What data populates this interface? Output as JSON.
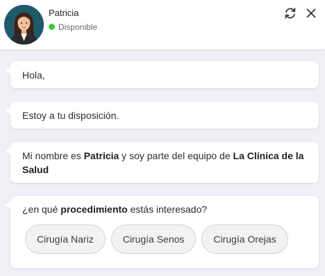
{
  "header": {
    "agent_name": "Patricia",
    "status": "Disponible",
    "status_color": "#43c63f",
    "icons": [
      "refresh-icon",
      "close-icon"
    ]
  },
  "messages": [
    {
      "text": "Hola,"
    },
    {
      "text": "Estoy a tu disposición."
    },
    {
      "parts": {
        "p1": "Mi nombre es ",
        "b1": "Patricia",
        "p2": " y soy parte del equipo de ",
        "b2": "La Clínica de la Salud"
      }
    },
    {
      "parts": {
        "p1": "¿en qué ",
        "b1": "procedimiento",
        "p2": " estás interesado?"
      },
      "options": [
        "Cirugía Nariz",
        "Cirugía Senos",
        "Cirugía Orejas"
      ]
    }
  ]
}
